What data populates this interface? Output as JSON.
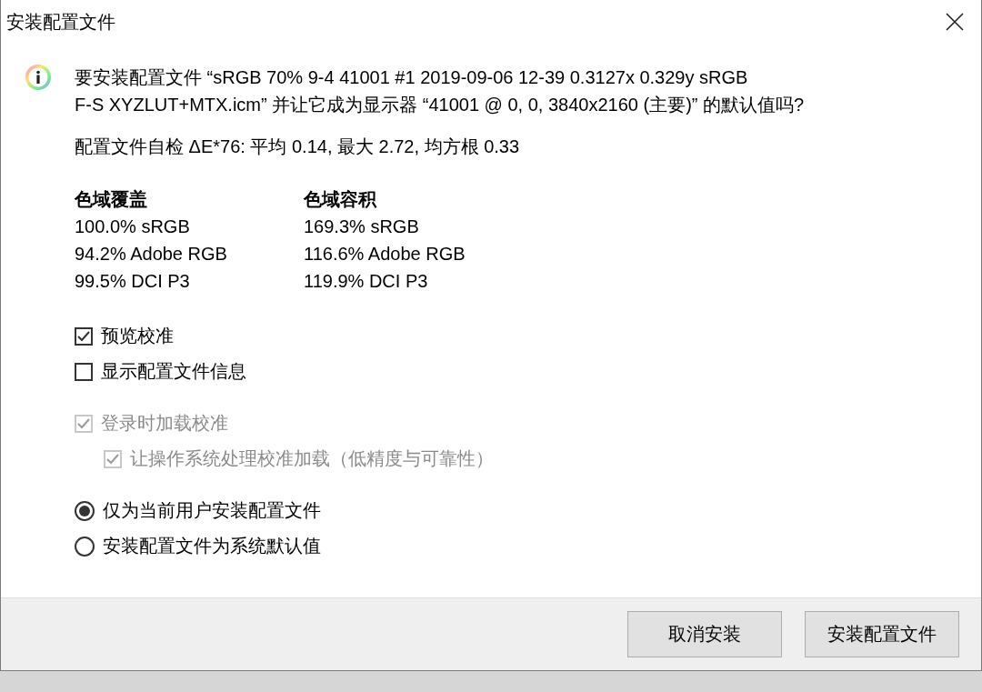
{
  "window": {
    "title": "安装配置文件"
  },
  "message_lines": [
    "要安装配置文件 “sRGB 70% 9-4 41001 #1 2019-09-06 12-39 0.3127x 0.329y sRGB",
    "F-S XYZLUT+MTX.icm” 并让它成为显示器 “41001 @ 0, 0, 3840x2160 (主要)” 的默认值吗?"
  ],
  "self_check": "配置文件自检 ΔE*76: 平均 0.14, 最大 2.72, 均方根 0.33",
  "gamut": [
    {
      "heading": "色域覆盖",
      "rows": [
        "100.0% sRGB",
        "94.2% Adobe RGB",
        "99.5% DCI P3"
      ]
    },
    {
      "heading": "色域容积",
      "rows": [
        "169.3% sRGB",
        "116.6% Adobe RGB",
        "119.9% DCI P3"
      ]
    }
  ],
  "options": [
    {
      "label": "预览校准",
      "checked": true,
      "disabled": false
    },
    {
      "label": "显示配置文件信息",
      "checked": false,
      "disabled": false
    }
  ],
  "login_options": [
    {
      "label": "登录时加载校准",
      "checked": true,
      "disabled": true,
      "children": [
        {
          "label": "让操作系统处理校准加载（低精度与可靠性）",
          "checked": true,
          "disabled": true
        }
      ]
    }
  ],
  "install_scope": [
    {
      "label": "仅为当前用户安装配置文件",
      "selected": true
    },
    {
      "label": "安装配置文件为系统默认值",
      "selected": false
    }
  ],
  "buttons": [
    "取消安装",
    "安装配置文件"
  ]
}
